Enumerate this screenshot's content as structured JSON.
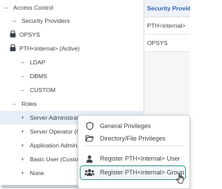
{
  "tree": {
    "access_control": "Access Control",
    "security_providers": "Security Providers",
    "opsys": "OPSYS",
    "pth_internal_active": "PTH<internal> (Active)",
    "ldap": "LDAP",
    "dbms": "DBMS",
    "custom": "CUSTOM",
    "roles": "Roles",
    "server_administrator": "Server Administrator",
    "server_operator": "Server Operator (Customiz",
    "application_administrator": "Application Administrator (",
    "basic_user": "Basic User (Customized)",
    "none": "None"
  },
  "right_panel": {
    "header": "Security Provider",
    "rows": [
      "PTH<internal>",
      "OPSYS"
    ]
  },
  "context_menu": {
    "general_privileges": "General Privileges",
    "directory_file_privileges": "Directory/File Privileges",
    "register_user": "Register PTH<internal> User",
    "register_group": "Register PTH<internal> Group"
  },
  "colors": {
    "accent": "#1d8a79",
    "header_text": "#2c5fb5",
    "selected_row": "#e8eef7"
  }
}
